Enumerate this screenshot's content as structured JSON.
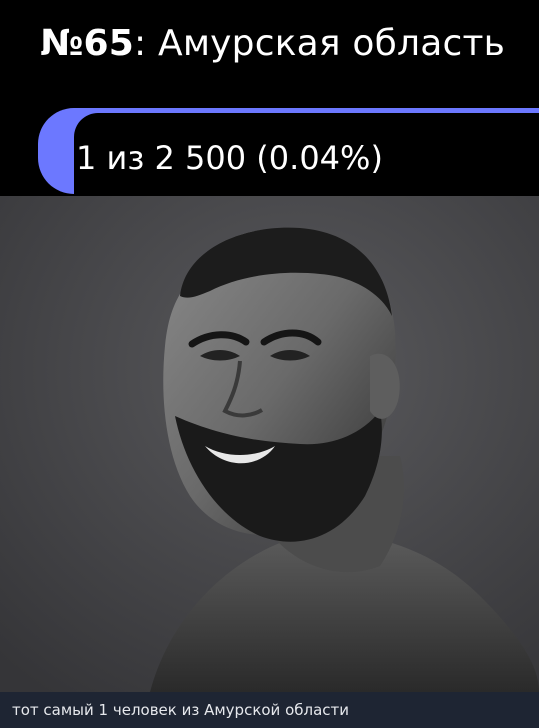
{
  "header": {
    "number": "№65",
    "region": ": Амурская область"
  },
  "progress": {
    "label": "1 из 2 500 (0.04%)",
    "fraction": 0.0004,
    "accent_color": "#6c78ff"
  },
  "caption": {
    "text": "тот самый 1 человек из Амурской области"
  }
}
